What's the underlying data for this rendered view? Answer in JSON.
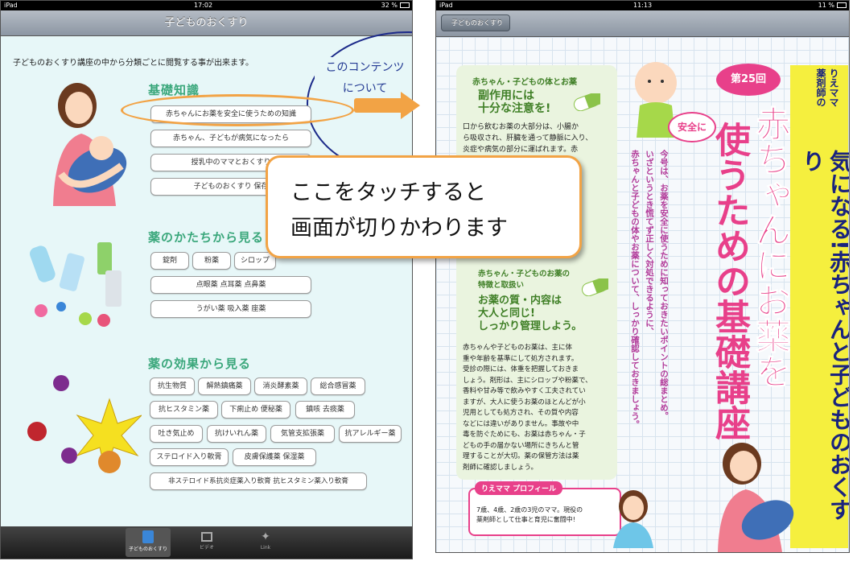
{
  "left": {
    "status": {
      "device": "iPad",
      "time": "17:02",
      "battery": "32 %"
    },
    "nav_title": "子どものおくすり",
    "intro": "子どものおくすり講座の中から分類ごとに閲覧する事が出来ます。",
    "contents_link": [
      "このコンテンツ",
      "について"
    ],
    "sections": [
      "基礎知識",
      "薬のかたちから見る",
      "薬の効果から見る"
    ],
    "basics": [
      "赤ちゃんにお薬を安全に使うための知識",
      "赤ちゃん、子どもが病気になったら",
      "授乳中のママとおくすり",
      "子どものおくすり 保存"
    ],
    "forms": [
      "錠剤",
      "粉薬",
      "シロップ",
      "点眼薬 点耳薬 点鼻薬",
      "うがい薬 吸入薬 座薬"
    ],
    "effects": [
      "抗生物質",
      "解熱鎮痛薬",
      "消炎酵素薬",
      "総合感冒薬",
      "抗ヒスタミン薬",
      "下痢止め 便秘薬",
      "鎮咳 去痰薬",
      "吐き気止め",
      "抗けいれん薬",
      "気管支拡張薬",
      "抗アレルギー薬",
      "ステロイド入り軟膏",
      "皮膚保護薬 保湿薬",
      "非ステロイド系抗炎症薬入り軟膏 抗ヒスタミン薬入り軟膏"
    ],
    "tabs": [
      "子どものおくすり",
      "ビデオ",
      "Link"
    ]
  },
  "callout": [
    "ここをタッチすると",
    "画面が切りかわります"
  ],
  "right": {
    "status": {
      "device": "iPad",
      "time": "11:13",
      "battery": "11 %"
    },
    "back_label": "子どものおくすり",
    "p1_label": "赤ちゃん・子どもの体とお薬",
    "p1_head": [
      "副作用には",
      "十分な注意を!"
    ],
    "p1_body": [
      "口から飲むお薬の大部分は、小腸か",
      "ら吸収され、肝臓を通って静脈に入り、",
      "炎症や病気の部分に運ばれます。赤"
    ],
    "p2_label": [
      "赤ちゃん・子どものお薬の",
      "特徴と取扱い"
    ],
    "p2_head": [
      "お薬の質・内容は",
      "大人と同じ!",
      "しっかり管理しよう。"
    ],
    "p2_body": [
      "赤ちゃんや子どものお薬は、主に体",
      "重や年齢を基準にして処方されます。",
      "受診の際には、体重を把握しておきま",
      "しょう。剤形は、主にシロップや粉薬で、",
      "香料や甘み等で飲みやすく工夫されてい",
      "ますが、大人に使うお薬のほとんどが小",
      "児用としても処方され、その質や内容",
      "などには違いがありません。事故や中",
      "毒を防ぐためにも、お薬は赤ちゃん・子",
      "どもの手の届かない場所にきちんと管",
      "理することが大切。薬の保管方法は薬",
      "剤師に確認しましょう。"
    ],
    "profile_title": "りえママ プロフィール",
    "profile_text": [
      "7歳、4歳、2歳の3児のママ。現役の",
      "薬剤師として仕事と育児に奮闘中!"
    ],
    "episode": "第25回",
    "safe": "安全に",
    "title": [
      "赤ちゃんにお薬を",
      "使うための基礎講座"
    ],
    "lead": [
      "今号は、お薬を安全に使うために知っておきたいポイントの総まとめ。",
      "いざというとき慌てず正しく対処できるように、",
      "赤ちゃんと子どもの体やお薬について、しっかり確認しておきましょう。"
    ],
    "series": [
      "りえママ",
      "薬剤師の"
    ],
    "series_title": "気になる!赤ちゃんと子どものおくすり"
  },
  "colors": {
    "accent": "#f2a345",
    "green": "#3aa77b",
    "pink": "#e8408a"
  }
}
